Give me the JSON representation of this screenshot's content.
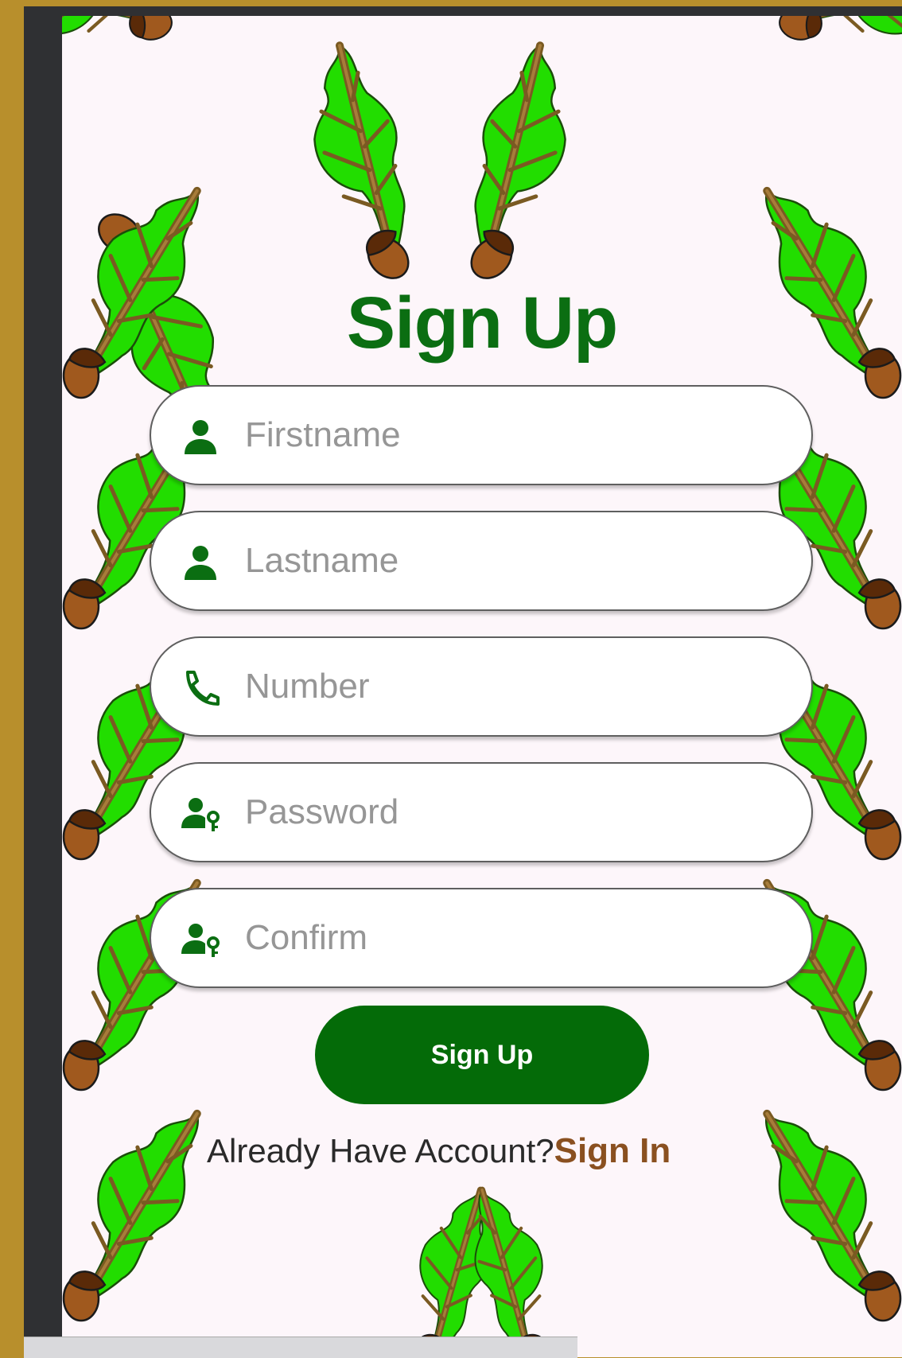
{
  "title": "Sign Up",
  "fields": [
    {
      "placeholder": "Firstname",
      "icon": "person-icon"
    },
    {
      "placeholder": "Lastname",
      "icon": "person-icon"
    },
    {
      "placeholder": "Number",
      "icon": "phone-icon"
    },
    {
      "placeholder": "Password",
      "icon": "person-key-icon"
    },
    {
      "placeholder": "Confirm",
      "icon": "person-key-icon"
    }
  ],
  "submit_label": "Sign Up",
  "footer": {
    "question": "Already Have Account?",
    "link": "Sign In"
  },
  "colors": {
    "primary_green": "#046b08",
    "title_green": "#0b6e12",
    "link_brown": "#8a5020",
    "screen_background": "#fdf6fa",
    "frame_gold": "#b88f2c",
    "leaf_green": "#22dd00",
    "acorn_brown": "#a0591e"
  }
}
